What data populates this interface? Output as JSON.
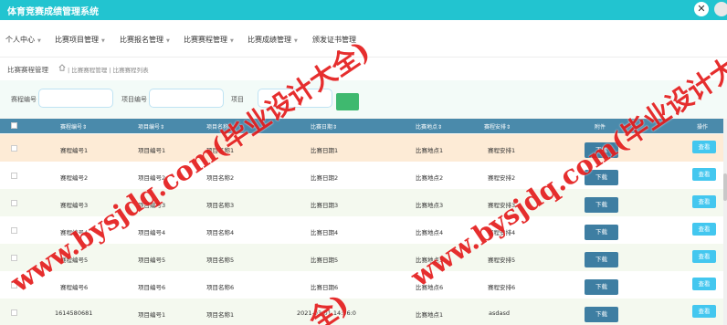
{
  "app": {
    "title": "体育竞赛成绩管理系统"
  },
  "menu": [
    {
      "label": "个人中心",
      "has_caret": true
    },
    {
      "label": "比赛项目管理",
      "has_caret": true
    },
    {
      "label": "比赛报名管理",
      "has_caret": true
    },
    {
      "label": "比赛赛程管理",
      "has_caret": true
    },
    {
      "label": "比赛成绩管理",
      "has_caret": true
    },
    {
      "label": "颁发证书管理",
      "has_caret": false
    }
  ],
  "breadcrumb": {
    "title": "比赛赛程管理",
    "path": "| 比赛赛程管理 | 比赛赛程列表"
  },
  "search": {
    "label1": "赛程编号",
    "label2": "项目编号",
    "label3": "项目"
  },
  "table": {
    "headers": [
      "赛程编号⇕",
      "项目编号⇕",
      "项目名称⇕",
      "比赛日期⇕",
      "比赛地点⇕",
      "赛程安排⇕",
      "附件",
      "操作"
    ],
    "download_label": "下载",
    "view_label": "查看",
    "rows": [
      [
        "赛程编号1",
        "项目编号1",
        "项目名称1",
        "比赛日期1",
        "比赛地点1",
        "赛程安排1"
      ],
      [
        "赛程编号2",
        "项目编号2",
        "项目名称2",
        "比赛日期2",
        "比赛地点2",
        "赛程安排2"
      ],
      [
        "赛程编号3",
        "项目编号3",
        "项目名称3",
        "比赛日期3",
        "比赛地点3",
        "赛程安排3"
      ],
      [
        "赛程编号4",
        "项目编号4",
        "项目名称4",
        "比赛日期4",
        "比赛地点4",
        "赛程安排4"
      ],
      [
        "赛程编号5",
        "项目编号5",
        "项目名称5",
        "比赛日期5",
        "比赛地点5",
        "赛程安排5"
      ],
      [
        "赛程编号6",
        "项目编号6",
        "项目名称6",
        "比赛日期6",
        "比赛地点6",
        "赛程安排6"
      ],
      [
        "1614580681",
        "项目编号1",
        "项目名称1",
        "2021-03-01 14:36:0",
        "比赛地点1",
        "asdasd"
      ]
    ]
  },
  "watermarks": [
    {
      "text": "www.bysjdq.com(毕业设计大全)"
    },
    {
      "text": "www.bysjdq.com(毕业设计大全)"
    },
    {
      "text": "全)"
    }
  ],
  "colors": {
    "topbar": "#22c4d0",
    "table_header": "#4a8aab",
    "download_button": "#3e7ea2",
    "view_button": "#43c7ef",
    "search_button": "#3fb96f",
    "watermark": "#e41d1d",
    "row_highlight": "#fdebd6",
    "row_alt": "#f4f9ef"
  },
  "icons": {
    "close": "close-icon",
    "avatar": "avatar",
    "home": "home-icon",
    "search": "search-icon"
  }
}
